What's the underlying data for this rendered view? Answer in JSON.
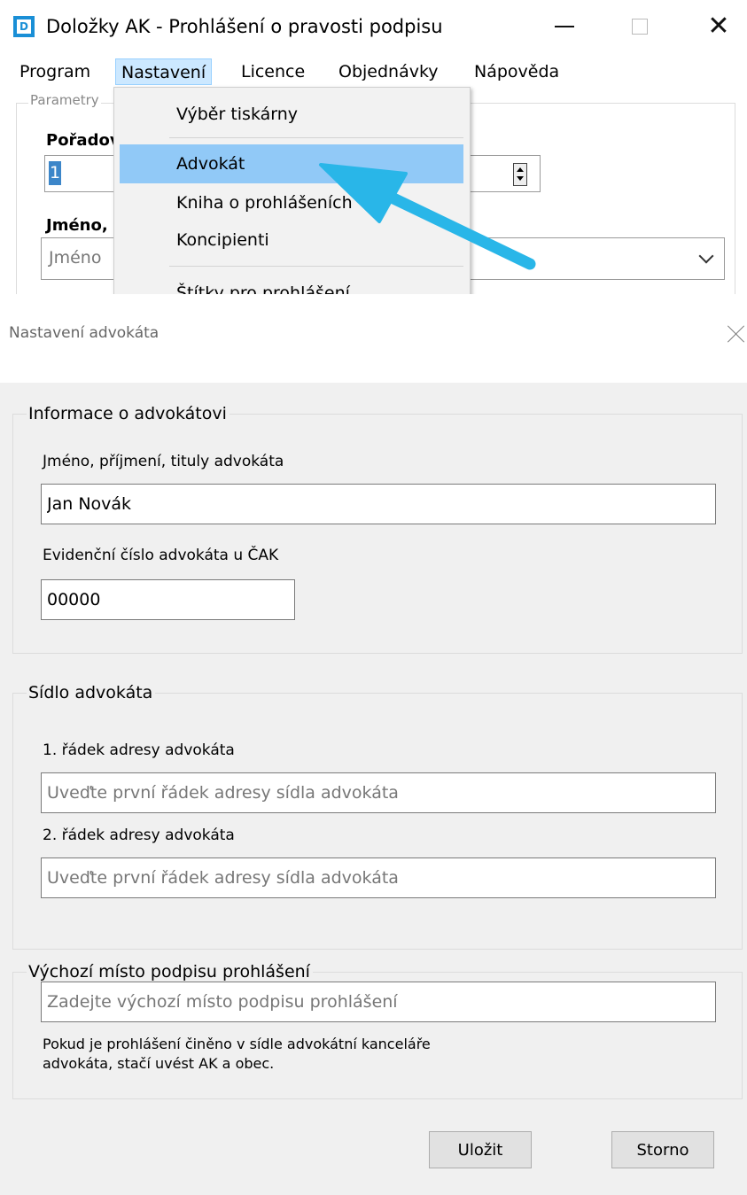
{
  "app": {
    "icon_letter": "D",
    "title": "Doložky AK - Prohlášení o pravosti podpisu",
    "close_glyph": "✕"
  },
  "menubar": {
    "items": [
      "Program",
      "Nastavení",
      "Licence",
      "Objednávky",
      "Nápověda"
    ],
    "active": "Nastavení"
  },
  "dropdown": {
    "items": [
      "Výběr tiskárny",
      "Advokát",
      "Kniha o prohlášeních",
      "Koncipienti",
      "Štítky pro prohlášení"
    ],
    "highlighted": "Advokát"
  },
  "background_form": {
    "group_legend": "Parametry",
    "order_label": "Pořadov",
    "order_value": "1",
    "name_label": "Jméno,",
    "name_placeholder": "Jméno"
  },
  "annotation": {
    "arrow_color": "#29b6e8",
    "points_to": "Advokát"
  },
  "dialog": {
    "title": "Nastavení advokáta",
    "info_group": {
      "legend": "Informace o advokátovi",
      "name_label": "Jméno, příjmení, tituly advokáta",
      "name_value": "Jan Novák",
      "reg_label": "Evidenční číslo advokáta u ČAK",
      "reg_value": "00000"
    },
    "seat_group": {
      "legend": "Sídlo advokáta",
      "line1_label": "1. řádek adresy advokáta",
      "line1_placeholder": "Uveďte první řádek adresy sídla advokáta",
      "line2_label": "2. řádek adresy advokáta",
      "line2_placeholder": "Uveďte první řádek adresy sídla advokáta"
    },
    "place_group": {
      "legend": "Výchozí místo podpisu prohlášení",
      "placeholder": "Zadejte výchozí místo podpisu prohlášení",
      "hint_line1": "Pokud je prohlášení činěno v sídle advokátní kanceláře",
      "hint_line2": "advokáta, stačí uvést AK a obec."
    },
    "buttons": {
      "save": "Uložit",
      "cancel": "Storno"
    }
  },
  "colors": {
    "menu_highlight": "#91c9f7",
    "active_menu": "#cce8ff",
    "app_icon": "#1a8fd6"
  }
}
